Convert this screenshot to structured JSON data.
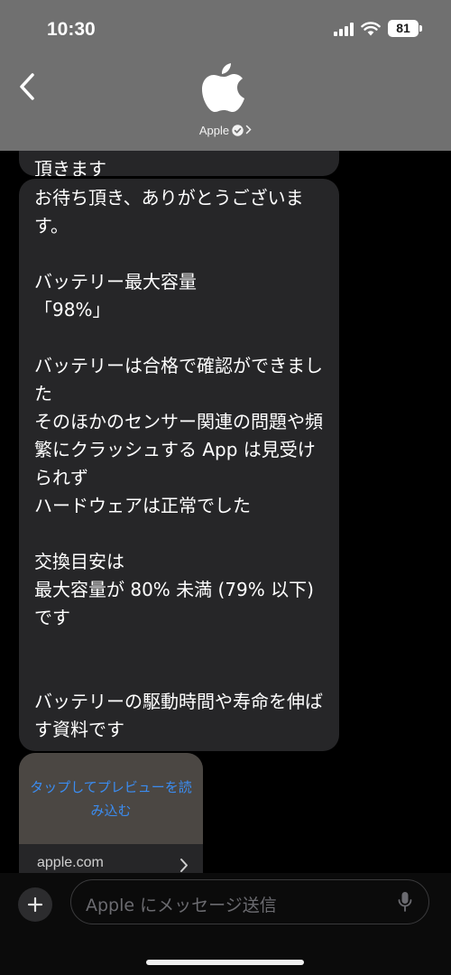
{
  "status_bar": {
    "time": "10:30",
    "battery": "81"
  },
  "header": {
    "contact_name": "Apple"
  },
  "messages": {
    "prev_tail": "頂きます",
    "main": "お待ち頂き、ありがとうございます。\n\nバッテリー最大容量\n「98%」\n\nバッテリーは合格で確認ができました\nそのほかのセンサー関連の問題や頻繁にクラッシュする App は見受けられず\nハードウェアは正常でした\n\n交換目安は\n最大容量が 80% 未満 (79% 以下)\nです\n\n\nバッテリーの駆動時間や寿命を伸ばす資料です"
  },
  "link_card": {
    "preview_label": "タップしてプレビューを読み込む",
    "domain": "apple.com"
  },
  "composer": {
    "placeholder": "Apple にメッセージ送信"
  },
  "colors": {
    "header_bg": "#707070",
    "bubble_bg": "#262628",
    "link_blue": "#3b8cf0",
    "preview_bg": "#4b4743"
  },
  "icons": [
    "back-chevron-icon",
    "apple-logo-icon",
    "verified-badge-icon",
    "chevron-right-icon",
    "plus-icon",
    "microphone-icon",
    "wifi-icon",
    "cellular-signal-icon",
    "battery-icon"
  ]
}
